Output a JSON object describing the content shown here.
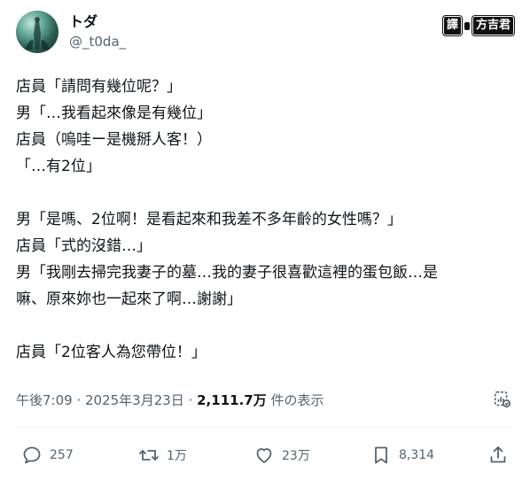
{
  "author": {
    "display_name": "トダ",
    "handle": "@_t0da_"
  },
  "watermark": {
    "left": "譯",
    "right": "方吉君"
  },
  "tweet": {
    "lines": [
      "店員「請問有幾位呢？」",
      "男「…我看起來像是有幾位」",
      "店員（嗚哇ー是機掰人客！）",
      "「…有2位」",
      "",
      "男「是嗎、2位啊！是看起來和我差不多年齡的女性嗎？」",
      "店員「式的沒錯…」",
      "男「我剛去掃完我妻子的墓…我的妻子很喜歡這裡的蛋包飯…是",
      "嘛、原來妳也一起來了啊…謝謝」",
      "",
      "店員「2位客人為您帶位！」"
    ]
  },
  "meta": {
    "time": "午後7:09",
    "separator": " · ",
    "date": "2025年3月23日",
    "views_number": "2,111.7万",
    "views_label": " 件の表示"
  },
  "actions": {
    "replies": "257",
    "retweets": "1万",
    "likes": "23万",
    "bookmarks": "8,314"
  },
  "icons": {
    "reply": "reply-icon",
    "retweet": "retweet-icon",
    "like": "heart-icon",
    "bookmark": "bookmark-icon",
    "share": "share-icon",
    "analytics": "analytics-icon"
  }
}
